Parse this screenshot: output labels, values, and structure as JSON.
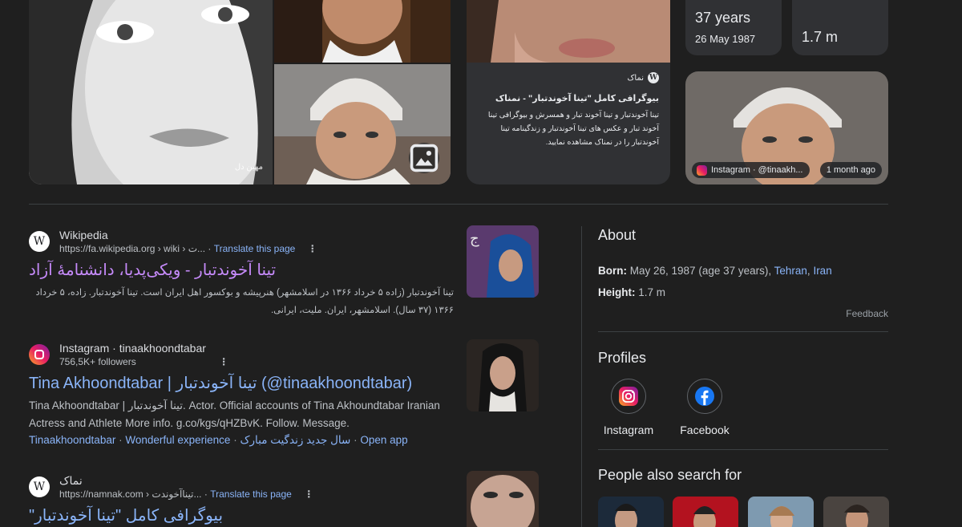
{
  "top_images": {
    "watermark": "مهین دل"
  },
  "namnak_card": {
    "site": "نماک",
    "title": "بیوگرافی کامل \"تینا آخوندتبار\" - نمناک",
    "description": "تینا آخوندتبار و تینا آخوند تبار و همسرش و بیوگرافی تینا آخوند تبار و عکس های تینا آخوندتبار و زندگینامه تینا آخوندتبار را در نمناک مشاهده نمایید."
  },
  "stats": {
    "age": "37 years",
    "birthdate": "26 May 1987",
    "height": "1.7 m"
  },
  "instagram_image": {
    "source": "Instagram · @tinaakh...",
    "time": "1 month ago"
  },
  "results": [
    {
      "source": "Wikipedia",
      "url": "https://fa.wikipedia.org › wiki › ت...",
      "translate": "Translate this page",
      "title": "تینا آخوندتبار - ویکی‌پدیا، دانشنامهٔ آزاد",
      "snippet": "تینا آخوندتبار (زاده ۵ خرداد ۱۳۶۶ در اسلامشهر) هنرپیشه و بوکسور اهل ایران است. تینا آخوندتبار. زاده، ۵ خرداد ۱۳۶۶ (۳۷ سال). اسلامشهر، ایران. ملیت، ایرانی."
    },
    {
      "source": "Instagram · tinaakhoondtabar",
      "followers": "756,5K+ followers",
      "title": "Tina Akhoondtabar | تینا آخوندتبار (@tinaakhoondtabar)",
      "snippet": "Tina Akhoondtabar | تینا آخوندتبار. Actor. Official accounts of Tina Akhoundtabar Iranian Actress and Athlete More info. g.co/kgs/qHZBvK. Follow. Message.",
      "sitelinks": [
        "Tinaakhoondtabar",
        "Wonderful experience",
        "سال جدید زندگیت مبارک",
        "Open app"
      ]
    },
    {
      "source": "نماک",
      "url": "https://namnak.com › تینا‌آخوندت...",
      "translate": "Translate this page",
      "title": "بیوگرافی کامل \"تینا آخوندتبار\""
    }
  ],
  "about": {
    "heading": "About",
    "born_label": "Born:",
    "born_value": "May 26, 1987 (age 37 years),",
    "born_city": "Tehran",
    "born_country": "Iran",
    "height_label": "Height:",
    "height_value": "1.7 m",
    "feedback": "Feedback"
  },
  "profiles": {
    "heading": "Profiles",
    "items": [
      {
        "label": "Instagram",
        "icon": "instagram-icon"
      },
      {
        "label": "Facebook",
        "icon": "facebook-icon"
      }
    ]
  },
  "people_also_search": {
    "heading": "People also search for"
  },
  "colors": {
    "background": "#1f1f1f",
    "link": "#8ab4f8",
    "visited": "#c58af9",
    "card": "#303134"
  }
}
